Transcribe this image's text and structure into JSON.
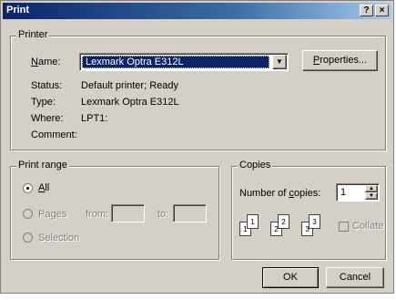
{
  "window": {
    "title": "Print",
    "help_glyph": "?",
    "close_glyph": "×"
  },
  "printer": {
    "group_label": "Printer",
    "name_label": "Name:",
    "name_value": "Lexmark Optra E312L",
    "properties_label": "Properties...",
    "status_label": "Status:",
    "status_value": "Default printer; Ready",
    "type_label": "Type:",
    "type_value": "Lexmark Optra E312L",
    "where_label": "Where:",
    "where_value": "LPT1:",
    "comment_label": "Comment:"
  },
  "print_range": {
    "group_label": "Print range",
    "all_label": "All",
    "pages_label": "Pages",
    "from_label": "from:",
    "to_label": "to:",
    "selection_label": "Selection",
    "selected": "all"
  },
  "copies": {
    "group_label": "Copies",
    "number_label": "Number of copies:",
    "number_value": "1",
    "collate_label": "Collate",
    "page_digits": [
      "1",
      "1",
      "2",
      "2",
      "3",
      "3"
    ]
  },
  "buttons": {
    "ok": "OK",
    "cancel": "Cancel"
  }
}
